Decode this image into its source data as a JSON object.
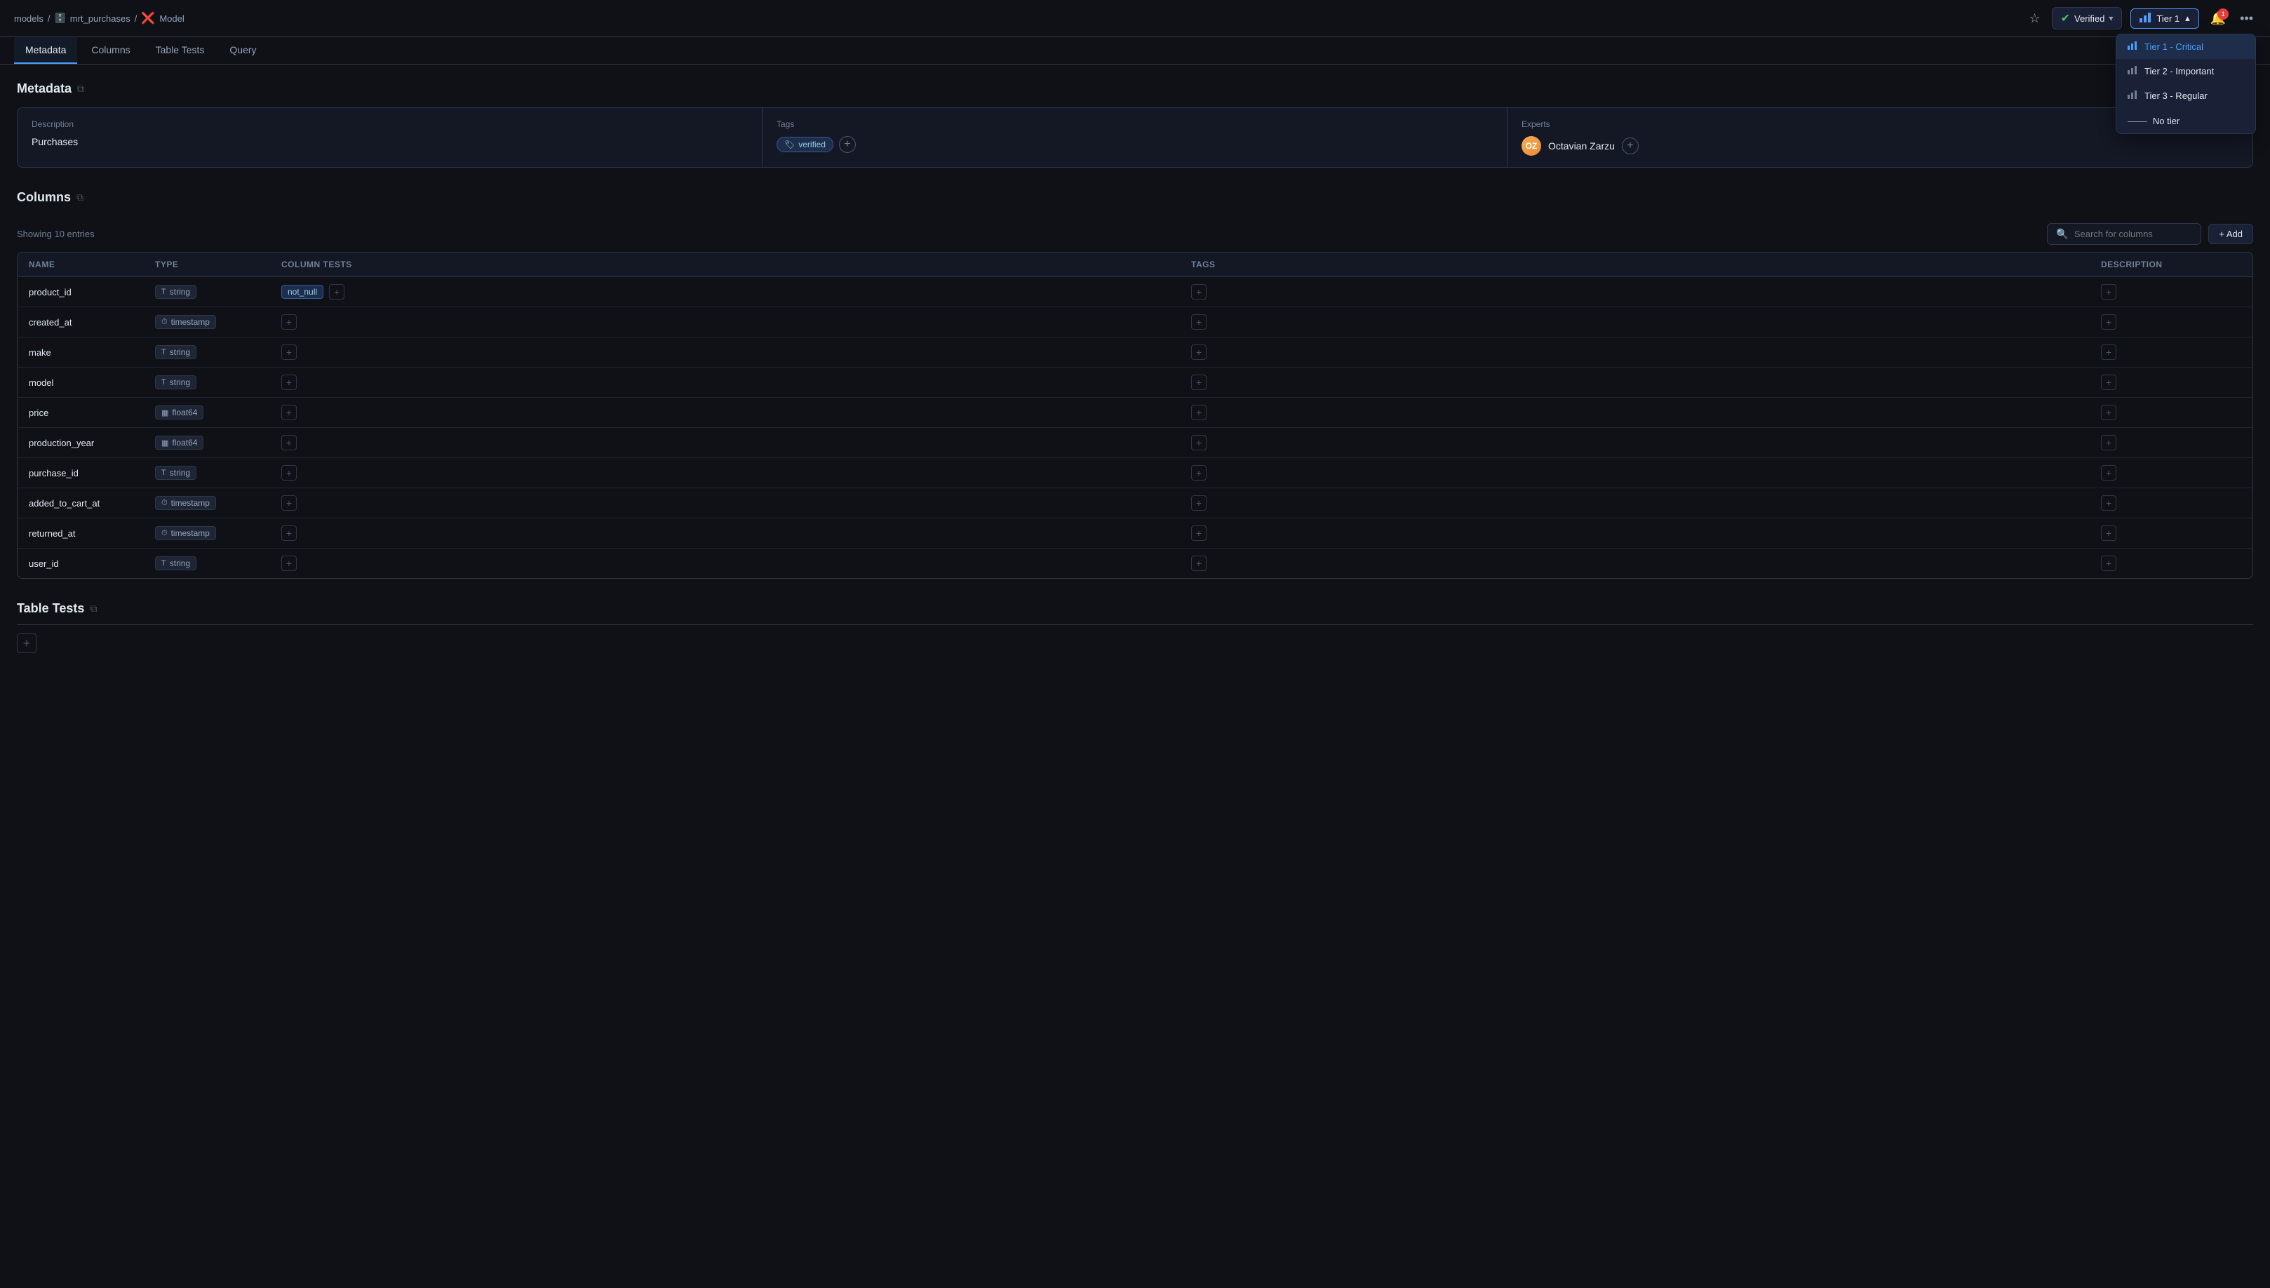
{
  "breadcrumb": {
    "models": "models",
    "sep1": "/",
    "mrt_purchases": "mrt_purchases",
    "sep2": "/",
    "model": "Model"
  },
  "topbar": {
    "star_label": "★",
    "verified_label": "Verified",
    "chevron": "▾",
    "tier_label": "Tier 1",
    "tier_bar_icon": "▐▐▐",
    "notif_count": "1",
    "more": "•••"
  },
  "tier_menu": {
    "items": [
      {
        "label": "Tier 1 - Critical",
        "icon": "bar",
        "active": true
      },
      {
        "label": "Tier 2 - Important",
        "icon": "bar",
        "active": false
      },
      {
        "label": "Tier 3 - Regular",
        "icon": "bar",
        "active": false
      },
      {
        "label": "No tier",
        "icon": "dash",
        "active": false
      }
    ]
  },
  "nav_tabs": [
    {
      "label": "Metadata",
      "active": true
    },
    {
      "label": "Columns",
      "active": false
    },
    {
      "label": "Table Tests",
      "active": false
    },
    {
      "label": "Query",
      "active": false
    }
  ],
  "metadata": {
    "section_title": "Metadata",
    "description_label": "Description",
    "description_value": "Purchases",
    "tags_label": "Tags",
    "tags": [
      {
        "label": "verified"
      }
    ],
    "experts_label": "Experts",
    "experts": [
      {
        "name": "Octavian Zarzu",
        "initials": "OZ"
      }
    ]
  },
  "columns": {
    "section_title": "Columns",
    "showing_text": "Showing 10 entries",
    "search_placeholder": "Search for columns",
    "add_label": "+ Add",
    "table_headers": [
      "Name",
      "Type",
      "Column Tests",
      "Tags",
      "Description"
    ],
    "rows": [
      {
        "name": "product_id",
        "type": "string",
        "type_icon": "T",
        "has_test": true,
        "test_label": "not_null"
      },
      {
        "name": "created_at",
        "type": "timestamp",
        "type_icon": "⏱",
        "has_test": false
      },
      {
        "name": "make",
        "type": "string",
        "type_icon": "T",
        "has_test": false
      },
      {
        "name": "model",
        "type": "string",
        "type_icon": "T",
        "has_test": false
      },
      {
        "name": "price",
        "type": "float64",
        "type_icon": "▦",
        "has_test": false
      },
      {
        "name": "production_year",
        "type": "float64",
        "type_icon": "▦",
        "has_test": false
      },
      {
        "name": "purchase_id",
        "type": "string",
        "type_icon": "T",
        "has_test": false
      },
      {
        "name": "added_to_cart_at",
        "type": "timestamp",
        "type_icon": "⏱",
        "has_test": false
      },
      {
        "name": "returned_at",
        "type": "timestamp",
        "type_icon": "⏱",
        "has_test": false
      },
      {
        "name": "user_id",
        "type": "string",
        "type_icon": "T",
        "has_test": false
      }
    ]
  },
  "table_tests": {
    "section_title": "Table Tests"
  }
}
